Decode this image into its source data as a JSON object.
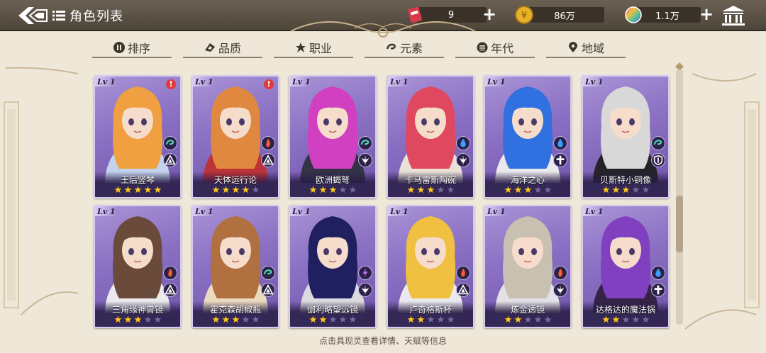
{
  "header": {
    "title": "角色列表",
    "resources": [
      {
        "icon": "ticket-icon",
        "value": "9",
        "has_plus": true,
        "color": "#d93a4a"
      },
      {
        "icon": "gold-coin-icon",
        "value": "86万",
        "has_plus": false,
        "color": "#e7b228"
      },
      {
        "icon": "rainbow-crystal-icon",
        "value": "1.1万",
        "has_plus": true,
        "color": "#9a6ad8"
      }
    ]
  },
  "tabs": [
    {
      "label": "排序",
      "icon": "sort-icon"
    },
    {
      "label": "品质",
      "icon": "quality-icon"
    },
    {
      "label": "职业",
      "icon": "job-icon"
    },
    {
      "label": "元素",
      "icon": "element-icon"
    },
    {
      "label": "年代",
      "icon": "era-icon"
    },
    {
      "label": "地域",
      "icon": "location-pin-icon"
    }
  ],
  "cards": [
    {
      "level": "Lv 1",
      "name": "王后竖琴",
      "stars": 5,
      "element": "wind",
      "job": "support",
      "alert": true,
      "hair": "#f0a040",
      "accent": "#c8d8f0"
    },
    {
      "level": "Lv 1",
      "name": "天体运行论",
      "stars": 4,
      "element": "fire",
      "job": "support",
      "alert": true,
      "hair": "#e08840",
      "accent": "#c03030"
    },
    {
      "level": "Lv 1",
      "name": "欧洲蝎弩",
      "stars": 3,
      "element": "wind",
      "job": "attack",
      "alert": false,
      "hair": "#d040c0",
      "accent": "#303040"
    },
    {
      "level": "Lv 1",
      "name": "卡马雷斯陶碗",
      "stars": 3,
      "element": "water",
      "job": "attack",
      "alert": false,
      "hair": "#e04860",
      "accent": "#f0e8d8"
    },
    {
      "level": "Lv 1",
      "name": "海洋之心",
      "stars": 3,
      "element": "water",
      "job": "heal",
      "alert": false,
      "hair": "#3070e0",
      "accent": "#f0f0f0"
    },
    {
      "level": "Lv 1",
      "name": "贝斯特小铜像",
      "stars": 3,
      "element": "wind",
      "job": "defense",
      "alert": false,
      "hair": "#d8d8d8",
      "accent": "#202020"
    },
    {
      "level": "Lv 1",
      "name": "三角缘神兽镜",
      "stars": 3,
      "element": "fire",
      "job": "support",
      "alert": false,
      "hair": "#6a4a3a",
      "accent": "#f0f0f0"
    },
    {
      "level": "Lv 1",
      "name": "霍克森胡椒瓶",
      "stars": 3,
      "element": "wind",
      "job": "support",
      "alert": false,
      "hair": "#b07040",
      "accent": "#f0e0c0"
    },
    {
      "level": "Lv 1",
      "name": "伽利略望远镜",
      "stars": 2,
      "element": "thunder",
      "job": "attack",
      "alert": false,
      "hair": "#202060",
      "accent": "#e0e0e0"
    },
    {
      "level": "Lv 1",
      "name": "卢奇格斯杯",
      "stars": 2,
      "element": "fire",
      "job": "support",
      "alert": false,
      "hair": "#f0c040",
      "accent": "#f0f0f0"
    },
    {
      "level": "Lv 1",
      "name": "炼金透镜",
      "stars": 2,
      "element": "fire",
      "job": "attack",
      "alert": false,
      "hair": "#c8c0b0",
      "accent": "#e8e8e8"
    },
    {
      "level": "Lv 1",
      "name": "达格达的魔法锅",
      "stars": 2,
      "element": "water",
      "job": "heal",
      "alert": false,
      "hair": "#8040c0",
      "accent": "#302040"
    }
  ],
  "footer": {
    "hint": "点击具现灵查看详情、天赋等信息"
  }
}
